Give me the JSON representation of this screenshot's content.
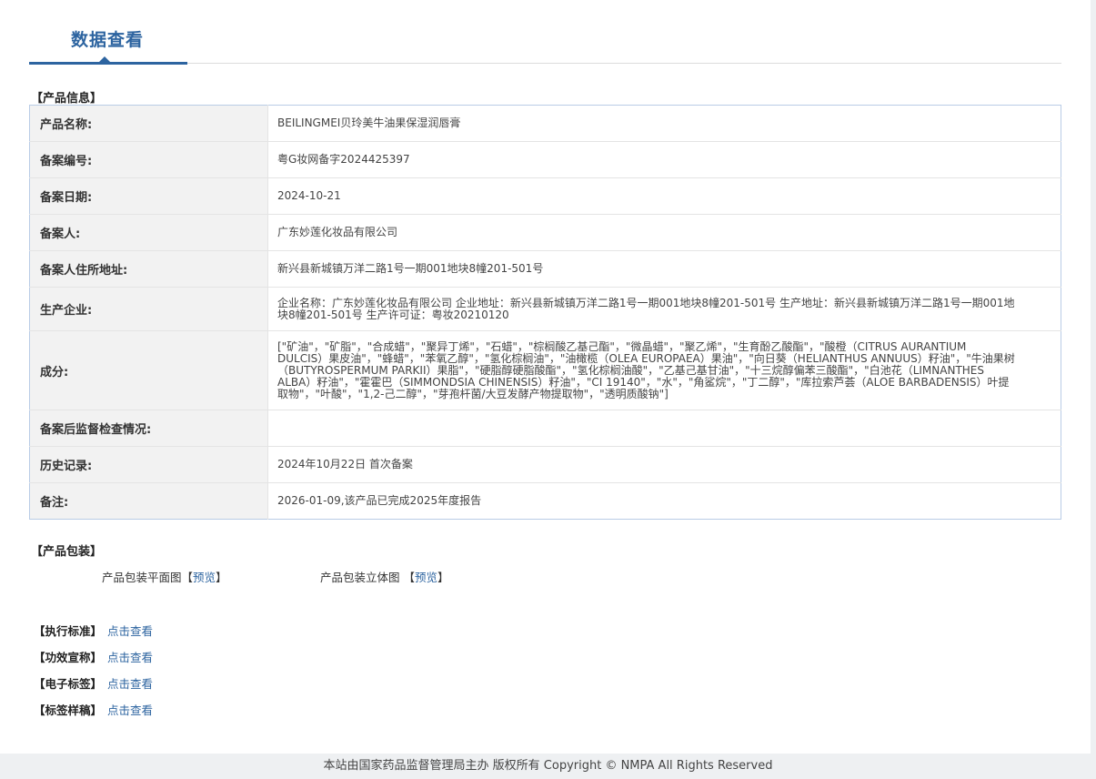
{
  "tab": {
    "title": "数据查看"
  },
  "product_info": {
    "section_title": "【产品信息】",
    "rows": [
      {
        "label": "产品名称:",
        "value": "BEILINGMEI贝玲美牛油果保湿润唇膏"
      },
      {
        "label": "备案编号:",
        "value": "粤G妆网备字2024425397"
      },
      {
        "label": "备案日期:",
        "value": "2024-10-21"
      },
      {
        "label": "备案人:",
        "value": "广东妙莲化妆品有限公司"
      },
      {
        "label": "备案人住所地址:",
        "value": "新兴县新城镇万洋二路1号一期001地块8幢201-501号"
      },
      {
        "label": "生产企业:",
        "value": "企业名称：广东妙莲化妆品有限公司 企业地址：新兴县新城镇万洋二路1号一期001地块8幢201-501号 生产地址：新兴县新城镇万洋二路1号一期001地块8幢201-501号 生产许可证：粤妆20210120"
      },
      {
        "label": "成分:",
        "value": "[\"矿油\"，\"矿脂\"，\"合成蜡\"，\"聚异丁烯\"，\"石蜡\"，\"棕榈酸乙基己酯\"，\"微晶蜡\"，\"聚乙烯\"，\"生育酚乙酸酯\"，\"酸橙（CITRUS AURANTIUM DULCIS）果皮油\"，\"蜂蜡\"，\"苯氧乙醇\"，\"氢化棕榈油\"，\"油橄榄（OLEA EUROPAEA）果油\"，\"向日葵（HELIANTHUS ANNUUS）籽油\"，\"牛油果树（BUTYROSPERMUM PARKII）果脂\"，\"硬脂醇硬脂酸酯\"，\"氢化棕榈油酸\"，\"乙基己基甘油\"，\"十三烷醇偏苯三酸酯\"，\"白池花（LIMNANTHES ALBA）籽油\"，\"霍霍巴（SIMMONDSIA CHINENSIS）籽油\"，\"CI 19140\"，\"水\"，\"角鲨烷\"，\"丁二醇\"，\"库拉索芦荟（ALOE BARBADENSIS）叶提取物\"，\"叶酸\"，\"1,2-己二醇\"，\"芽孢杆菌/大豆发酵产物提取物\"，\"透明质酸钠\"]"
      },
      {
        "label": "备案后监督检查情况:",
        "value": ""
      },
      {
        "label": "历史记录:",
        "value": "2024年10月22日 首次备案"
      },
      {
        "label": "备注:",
        "value": "2026-01-09,该产品已完成2025年度报告"
      }
    ]
  },
  "packaging": {
    "section_title": "【产品包装】",
    "flat_label": "产品包装平面图",
    "solid_label": "产品包装立体图",
    "bracket_open": "【",
    "bracket_close": "】",
    "preview_link": "预览"
  },
  "standards": [
    {
      "label": "【执行标准】",
      "link": "点击查看"
    },
    {
      "label": "【功效宣称】",
      "link": "点击查看"
    },
    {
      "label": "【电子标签】",
      "link": "点击查看"
    },
    {
      "label": "【标签样稿】",
      "link": "点击查看"
    }
  ],
  "footer": {
    "text": "本站由国家药品监督管理局主办 版权所有 Copyright © NMPA All Rights Reserved"
  }
}
